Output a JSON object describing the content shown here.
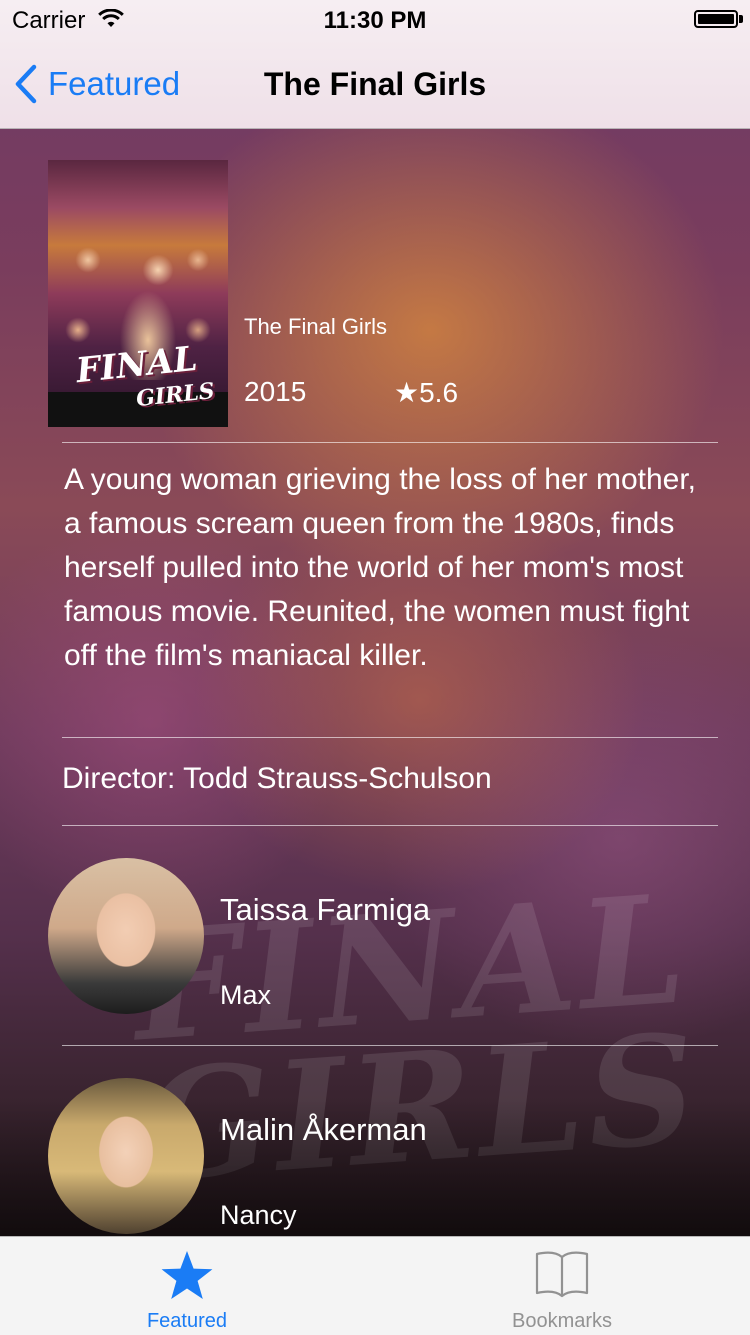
{
  "status_bar": {
    "carrier": "Carrier",
    "time": "11:30 PM"
  },
  "nav": {
    "back_label": "Featured",
    "title": "The Final Girls"
  },
  "movie": {
    "title": "The Final Girls",
    "year": "2015",
    "rating": "★5.6",
    "poster_title": "FINAL",
    "poster_subtitle": "GIRLS",
    "synopsis": "A young woman grieving the loss of her mother, a famous scream queen from the 1980s, finds herself pulled into the world of her mom's most famous movie. Reunited, the women must fight off the film's maniacal killer.",
    "director": "Director: Todd Strauss-Schulson"
  },
  "cast": [
    {
      "name": "Taissa Farmiga",
      "role": "Max"
    },
    {
      "name": "Malin Åkerman",
      "role": "Nancy"
    }
  ],
  "tabs": {
    "featured_label": "Featured",
    "bookmarks_label": "Bookmarks"
  },
  "colors": {
    "accent": "#1a7cf5",
    "inactive_tab": "#929292"
  }
}
